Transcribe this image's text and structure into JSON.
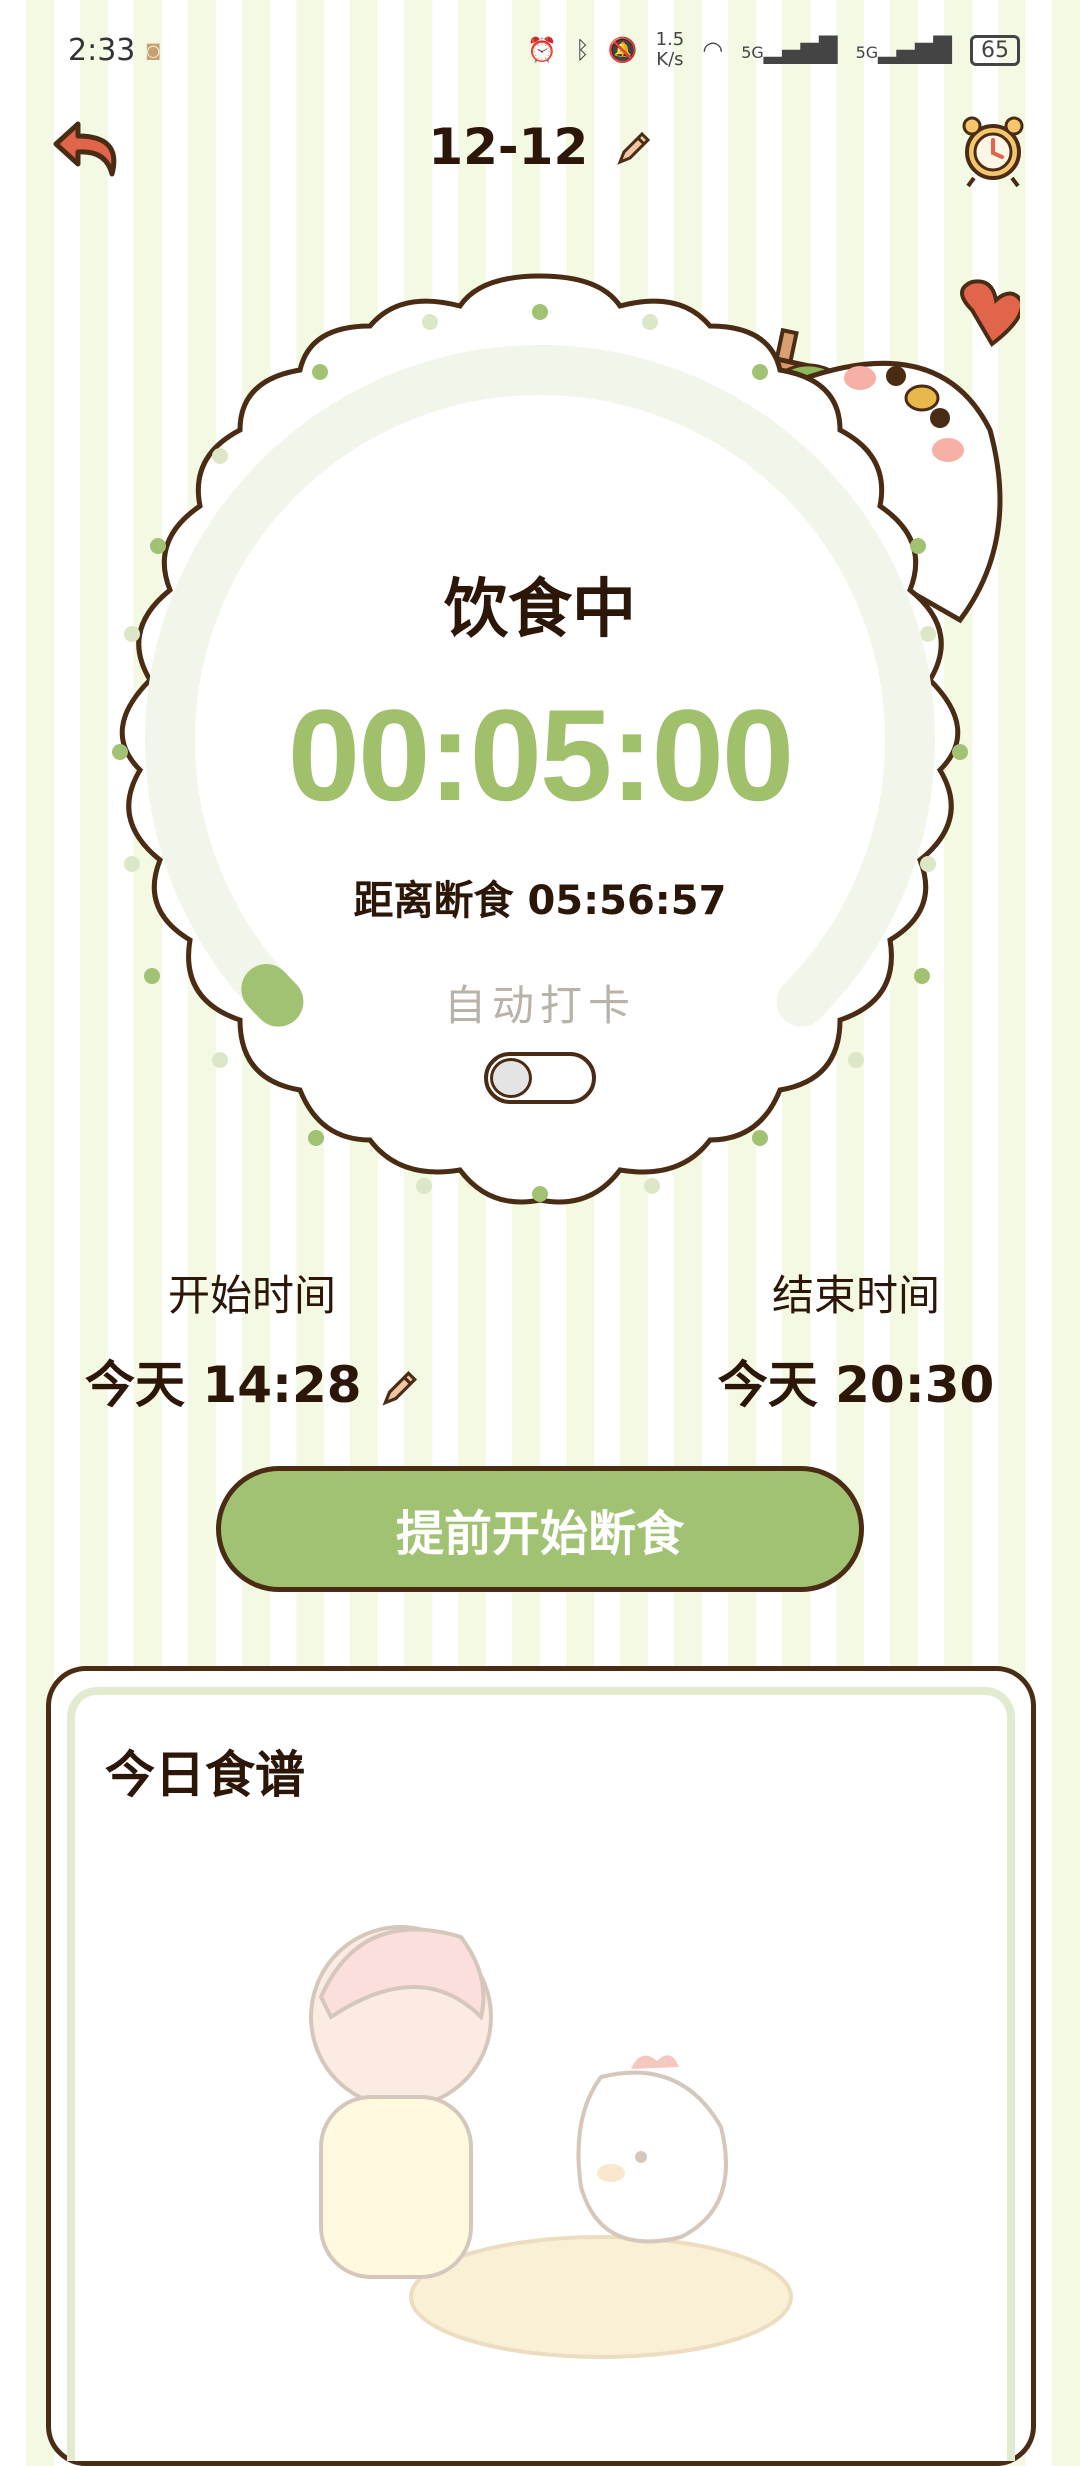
{
  "status_bar": {
    "time": "2:33",
    "speed_value": "1.5",
    "speed_unit": "K/s",
    "network_1": "5G",
    "network_2": "5G",
    "battery": "65"
  },
  "header": {
    "date": "12-12",
    "back_icon": "back-arrow-icon",
    "alarm_icon": "alarm-clock-icon",
    "edit_icon": "pencil-icon"
  },
  "timer_panel": {
    "state_label": "饮食中",
    "elapsed": "00:05:00",
    "countdown": "距离断食 05:56:57",
    "auto_checkin_label": "自动打卡",
    "auto_checkin_on": false,
    "progress_fraction": 0.01
  },
  "times": {
    "start_label": "开始时间",
    "start_value": "今天 14:28",
    "end_label": "结束时间",
    "end_value": "今天 20:30"
  },
  "actions": {
    "main_button": "提前开始断食"
  },
  "recipe": {
    "title": "今日食谱"
  },
  "colors": {
    "accent_green": "#a2c273",
    "timer_green": "#a0c06c",
    "outline_brown": "#4a2c14",
    "back_arrow": "#e0654a"
  }
}
